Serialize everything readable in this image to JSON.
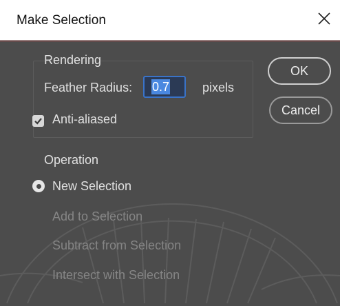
{
  "dialog": {
    "title": "Make Selection",
    "close_icon": "close-icon"
  },
  "rendering": {
    "group_label": "Rendering",
    "feather_radius_label": "Feather Radius:",
    "feather_radius_value": "0.7",
    "feather_radius_unit": "pixels",
    "anti_aliased_label": "Anti-aliased",
    "anti_aliased_checked": true
  },
  "operation": {
    "group_label": "Operation",
    "options": [
      {
        "label": "New Selection",
        "selected": true,
        "enabled": true
      },
      {
        "label": "Add to Selection",
        "selected": false,
        "enabled": false
      },
      {
        "label": "Subtract from Selection",
        "selected": false,
        "enabled": false
      },
      {
        "label": "Intersect with Selection",
        "selected": false,
        "enabled": false
      }
    ]
  },
  "buttons": {
    "ok_label": "OK",
    "cancel_label": "Cancel"
  },
  "colors": {
    "panel_bg": "#4c4c4c",
    "titlebar_bg": "#ffffff",
    "input_highlight": "#4a88e0"
  }
}
